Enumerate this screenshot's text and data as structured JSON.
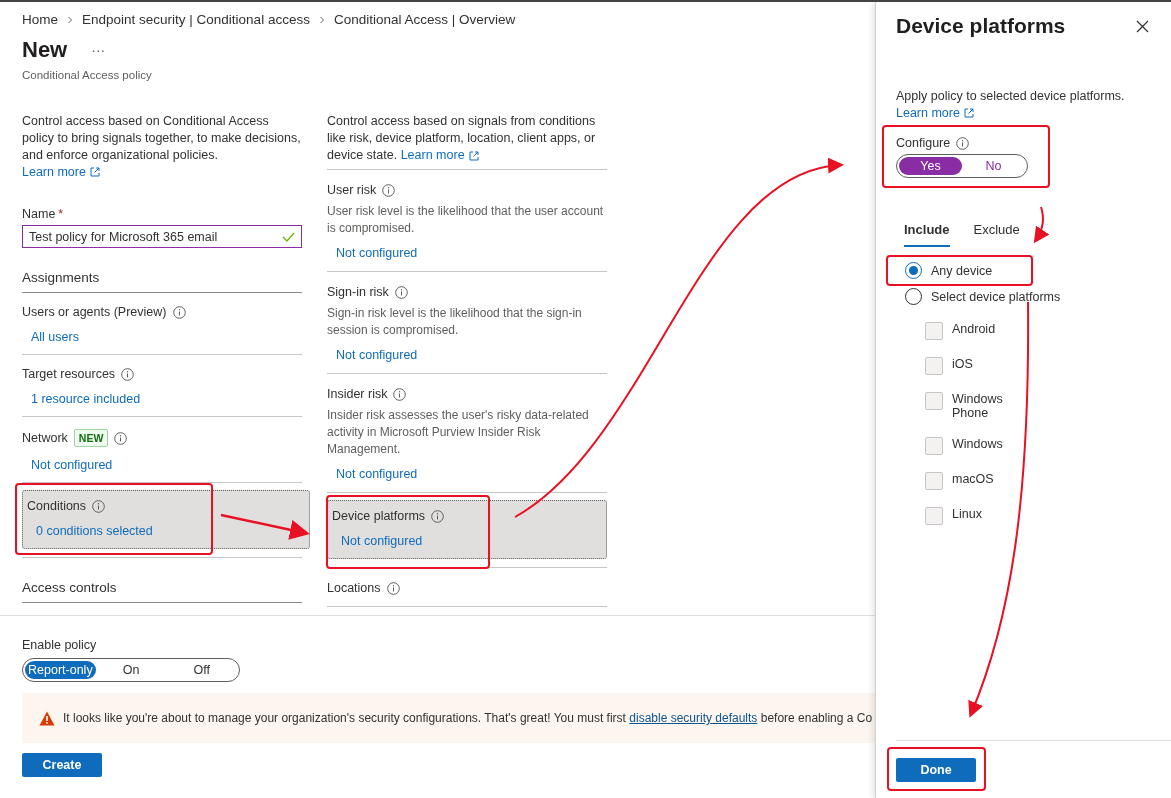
{
  "breadcrumb": [
    "Home",
    "Endpoint security | Conditional access",
    "Conditional Access | Overview"
  ],
  "page": {
    "title": "New",
    "more": "···",
    "subtitle": "Conditional Access policy"
  },
  "intro": {
    "text": "Control access based on Conditional Access policy to bring signals together, to make decisions, and enforce organizational policies.",
    "link": "Learn more"
  },
  "name_field": {
    "label": "Name",
    "required_mark": "*",
    "value": "Test policy for Microsoft 365 email",
    "valid": true
  },
  "assignments": {
    "heading": "Assignments",
    "items": [
      {
        "label": "Users or agents (Preview)",
        "value": "All users",
        "selected": false
      },
      {
        "label": "Target resources",
        "value": "1 resource included",
        "selected": false
      },
      {
        "label": "Network",
        "badge": "NEW",
        "value": "Not configured",
        "selected": false
      },
      {
        "label": "Conditions",
        "value": "0 conditions selected",
        "selected": true
      }
    ]
  },
  "access_controls": {
    "heading": "Access controls"
  },
  "conditions": {
    "intro": {
      "text": "Control access based on signals from conditions like risk, device platform, location, client apps, or device state.",
      "link": "Learn more"
    },
    "items": [
      {
        "label": "User risk",
        "description": "User risk level is the likelihood that the user account is compromised.",
        "value": "Not configured",
        "selected": false
      },
      {
        "label": "Sign-in risk",
        "description": "Sign-in risk level is the likelihood that the sign-in session is compromised.",
        "value": "Not configured",
        "selected": false
      },
      {
        "label": "Insider risk",
        "description": "Insider risk assesses the user's risky data-related activity in Microsoft Purview Insider Risk Management.",
        "value": "Not configured",
        "selected": false
      },
      {
        "label": "Device platforms",
        "value": "Not configured",
        "selected": true
      },
      {
        "label": "Locations",
        "selected": false
      }
    ]
  },
  "enable_policy": {
    "label": "Enable policy",
    "options": [
      {
        "label": "Report-only",
        "selected": true
      },
      {
        "label": "On",
        "selected": false
      },
      {
        "label": "Off",
        "selected": false
      }
    ]
  },
  "banner": {
    "before": "It looks like you're about to manage your organization's security configurations. That's great! You must first",
    "link": "disable security defaults",
    "after": "before enabling a Co"
  },
  "create_button": "Create",
  "panel": {
    "title": "Device platforms",
    "description": "Apply policy to selected device platforms.",
    "link": "Learn more",
    "configure": {
      "label": "Configure",
      "options": [
        {
          "label": "Yes",
          "selected": true
        },
        {
          "label": "No",
          "selected": false
        }
      ]
    },
    "tabs": [
      {
        "label": "Include",
        "selected": true
      },
      {
        "label": "Exclude",
        "selected": false
      }
    ],
    "choices": [
      {
        "label": "Any device",
        "selected": true
      },
      {
        "label": "Select device platforms",
        "selected": false
      }
    ],
    "platforms": [
      {
        "label": "Android",
        "checked": false
      },
      {
        "label": "iOS",
        "checked": false
      },
      {
        "label": "Windows Phone",
        "checked": false
      },
      {
        "label": "Windows",
        "checked": false
      },
      {
        "label": "macOS",
        "checked": false
      },
      {
        "label": "Linux",
        "checked": false
      }
    ],
    "done_button": "Done"
  }
}
